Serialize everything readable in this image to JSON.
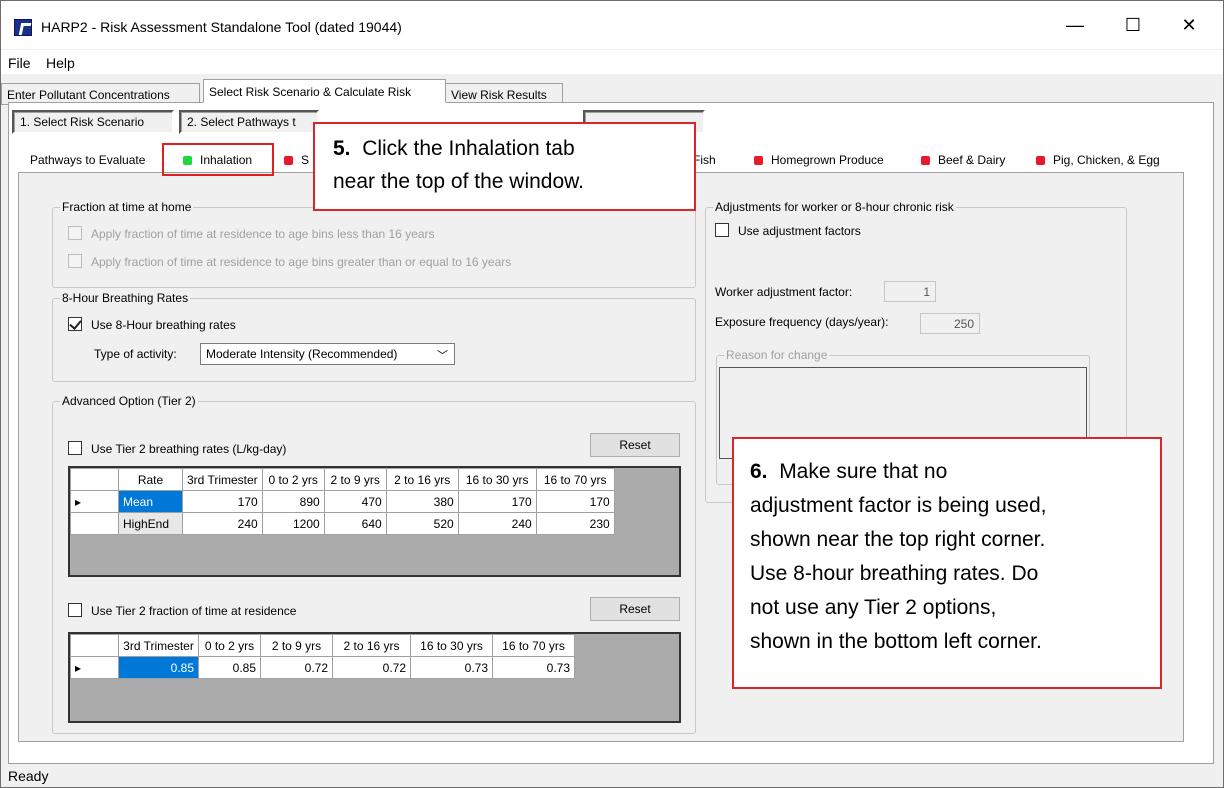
{
  "window": {
    "title": "HARP2 - Risk Assessment Standalone Tool (dated 19044)",
    "minimize": "—",
    "maximize": "☐",
    "close": "✕"
  },
  "menu": [
    "File",
    "Help"
  ],
  "main_tabs": [
    "Enter Pollutant Concentrations",
    "Select Risk Scenario & Calculate Risk",
    "View Risk Results"
  ],
  "sub_steps": [
    "1. Select Risk Scenario",
    "2. Select Pathways t"
  ],
  "pathway_tabs": {
    "first": "Pathways to Evaluate",
    "inhalation": "Inhalation",
    "s": "S",
    "fish": "Fish",
    "produce": "Homegrown Produce",
    "beef": "Beef & Dairy",
    "pig": "Pig, Chicken, & Egg"
  },
  "fraction_home": {
    "title": "Fraction at time at home",
    "opt1": "Apply fraction of time at residence to age bins less than 16 years",
    "opt2": "Apply fraction of time at residence to age bins greater than or equal to 16 years"
  },
  "breathing": {
    "title": "8-Hour Breathing Rates",
    "use_label": "Use 8-Hour breathing rates",
    "activity_label": "Type of activity:",
    "activity_value": "Moderate Intensity (Recommended)"
  },
  "advanced": {
    "title": "Advanced Option (Tier 2)",
    "tier2_rates_label": "Use Tier 2 breathing rates (L/kg-day)",
    "reset": "Reset",
    "rates_headers": [
      "Rate",
      "3rd Trimester",
      "0 to 2 yrs",
      "2 to 9 yrs",
      "2 to 16 yrs",
      "16 to 30 yrs",
      "16 to 70 yrs"
    ],
    "rates_rows": [
      [
        "Mean",
        "170",
        "890",
        "470",
        "380",
        "170",
        "170"
      ],
      [
        "HighEnd",
        "240",
        "1200",
        "640",
        "520",
        "240",
        "230"
      ]
    ],
    "tier2_fraction_label": "Use Tier 2 fraction of time at residence",
    "fraction_headers": [
      "3rd Trimester",
      "0 to 2 yrs",
      "2 to 9 yrs",
      "2 to 16 yrs",
      "16 to 30 yrs",
      "16 to 70 yrs"
    ],
    "fraction_row": [
      "0.85",
      "0.85",
      "0.72",
      "0.72",
      "0.73",
      "0.73"
    ]
  },
  "adjust": {
    "title": "Adjustments for worker or 8-hour chronic risk",
    "use_label": "Use adjustment factors",
    "worker_label": "Worker adjustment factor:",
    "worker_value": "1",
    "freq_label": "Exposure frequency (days/year):",
    "freq_value": "250",
    "reason_label": "Reason for change"
  },
  "callout5": {
    "num": "5.",
    "line1": "Click the Inhalation tab",
    "line2": "near the top of the window."
  },
  "callout6": {
    "num": "6.",
    "line1": "Make sure that no",
    "line2": "adjustment factor is being used,",
    "line3": "shown near the top right corner.",
    "line4": "Use 8-hour breathing rates.  Do",
    "line5": "not use any Tier 2 options,",
    "line6": "shown in the bottom left corner."
  },
  "status": "Ready",
  "colors": {
    "accent": "#0078d7",
    "callout_border": "#d9262c",
    "dot_red": "#e8192c",
    "dot_green": "#1fd83d"
  }
}
